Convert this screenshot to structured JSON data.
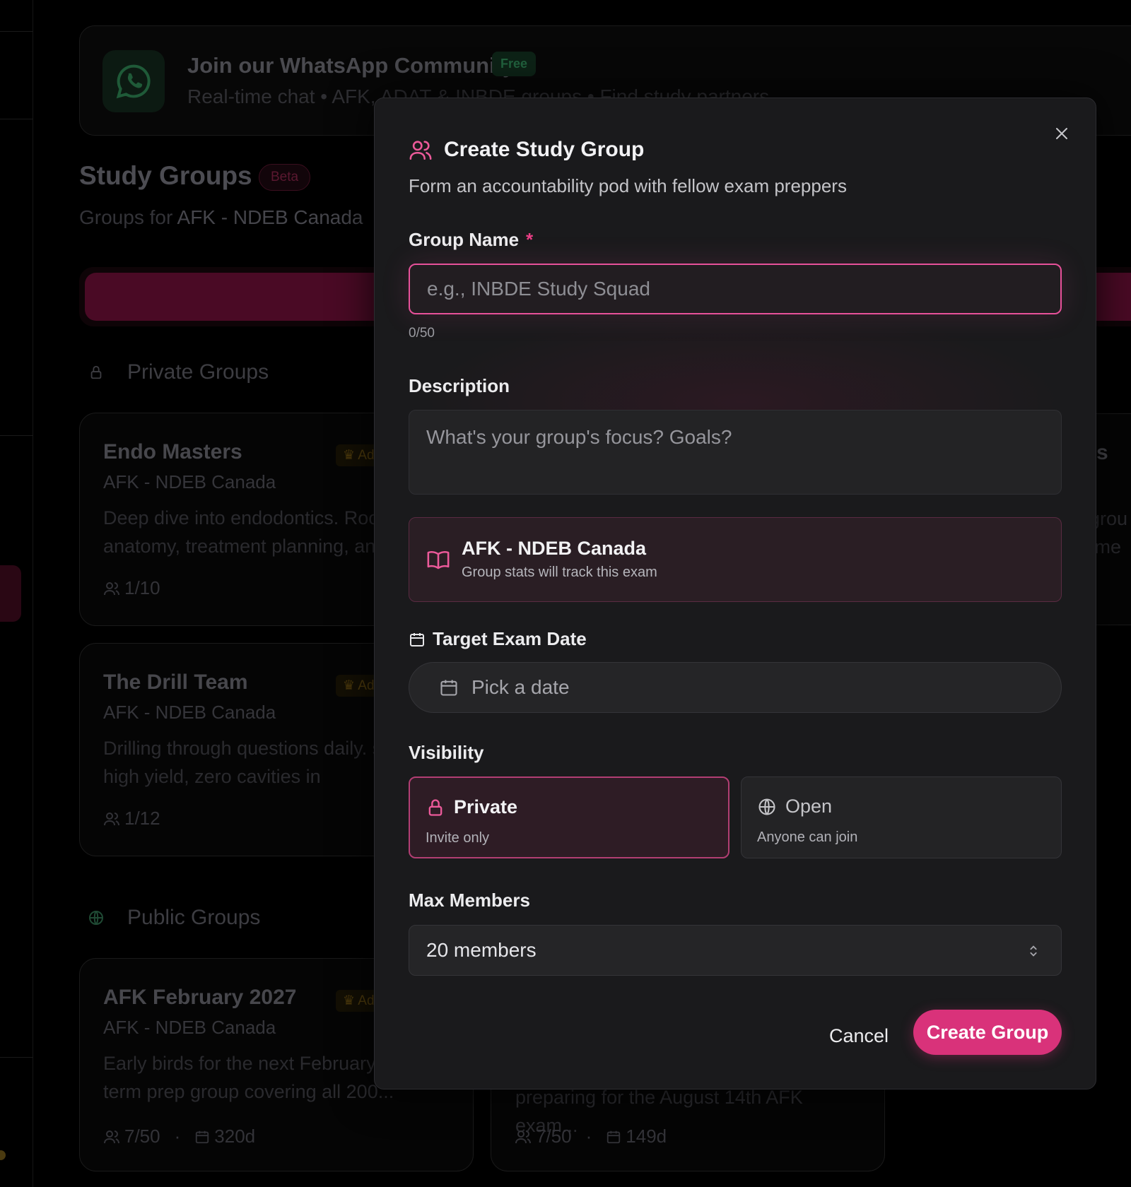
{
  "background": {
    "whatsapp": {
      "title": "Join our WhatsApp Community",
      "badge": "Free",
      "subtitle": "Real-time chat • AFK, ADAT & INBDE groups • Find study partners"
    },
    "study_groups": {
      "title": "Study Groups",
      "badge": "Beta",
      "subtitle_prefix": "Groups for ",
      "subtitle_exam": "AFK - NDEB Canada"
    },
    "private_section": "Private Groups",
    "public_section": "Public Groups",
    "cards": [
      {
        "name": "Endo Masters",
        "admin": "Ad",
        "exam": "AFK - NDEB Canada",
        "desc": "Deep dive into endodontics. Root anatomy, treatment planning, an",
        "members": "1/10"
      },
      {
        "name": "The Drill Team",
        "admin": "Ad",
        "exam": "AFK - NDEB Canada",
        "desc": "Drilling through questions daily. speed, high yield, zero cavities in",
        "members": "1/12"
      },
      {
        "name": "AFK February 2027",
        "admin": "Ad",
        "exam": "AFK - NDEB Canada",
        "desc": "Early birds for the next February. Long-term prep group covering all 200...",
        "members": "7/50",
        "days": "320d"
      },
      {
        "members": "7/50",
        "days": "149d",
        "desc": "preparing for the August 14th AFK exam..."
      }
    ],
    "right_card": {
      "title": "ts",
      "desc": "grou\ntme"
    }
  },
  "modal": {
    "title": "Create Study Group",
    "subtitle": "Form an accountability pod with fellow exam preppers",
    "group_name": {
      "label": "Group Name",
      "required_mark": "*",
      "placeholder": "e.g., INBDE Study Squad",
      "value": "",
      "counter": "0/50"
    },
    "description": {
      "label": "Description",
      "placeholder": "What's your group's focus? Goals?"
    },
    "exam": {
      "name": "AFK - NDEB Canada",
      "note": "Group stats will track this exam"
    },
    "target_date": {
      "label": "Target Exam Date",
      "placeholder": "Pick a date"
    },
    "visibility": {
      "label": "Visibility",
      "options": [
        {
          "title": "Private",
          "sub": "Invite only",
          "selected": true
        },
        {
          "title": "Open",
          "sub": "Anyone can join",
          "selected": false
        }
      ]
    },
    "max_members": {
      "label": "Max Members",
      "value": "20 members"
    },
    "buttons": {
      "cancel": "Cancel",
      "create": "Create Group"
    }
  },
  "colors": {
    "accent": "#d9327a",
    "accent_border": "#e7519a",
    "modal_bg": "#1a1a1c",
    "page_bg": "#000000"
  },
  "icons": [
    "whatsapp-icon",
    "lock-icon",
    "globe-icon",
    "users-icon",
    "crown-icon",
    "calendar-icon",
    "book-icon",
    "close-icon",
    "chevron-updown-icon"
  ]
}
